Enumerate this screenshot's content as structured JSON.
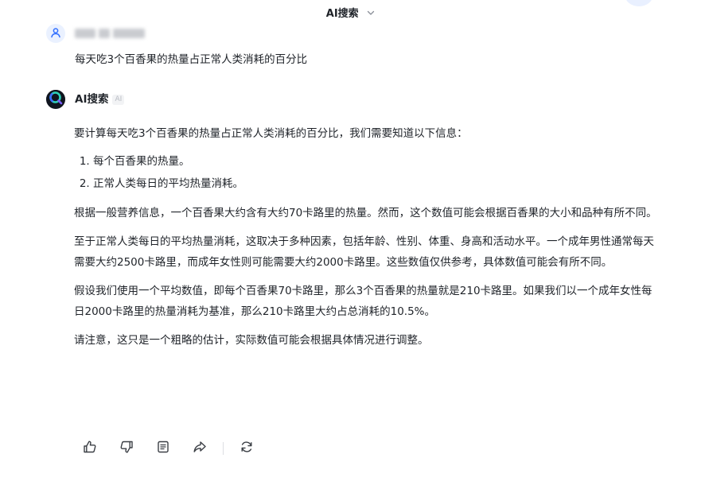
{
  "header": {
    "title": "AI搜索",
    "dropdown_icon": "chevron-down-icon"
  },
  "user": {
    "avatar_icon": "user-icon",
    "name_redacted": true,
    "question": "每天吃3个百香果的热量占正常人类消耗的百分比"
  },
  "ai": {
    "avatar_icon": "ai-search-logo",
    "name": "AI搜索",
    "badge": "AI",
    "intro": "要计算每天吃3个百香果的热量占正常人类消耗的百分比，我们需要知道以下信息：",
    "list": [
      "每个百香果的热量。",
      "正常人类每日的平均热量消耗。"
    ],
    "paragraphs": [
      "根据一般营养信息，一个百香果大约含有大约70卡路里的热量。然而，这个数值可能会根据百香果的大小和品种有所不同。",
      "至于正常人类每日的平均热量消耗，这取决于多种因素，包括年龄、性别、体重、身高和活动水平。一个成年男性通常每天需要大约2500卡路里，而成年女性则可能需要大约2000卡路里。这些数值仅供参考，具体数值可能会有所不同。",
      "假设我们使用一个平均数值，即每个百香果70卡路里，那么3个百香果的热量就是210卡路里。如果我们以一个成年女性每日2000卡路里的热量消耗为基准，那么210卡路里大约占总消耗的10.5%。",
      "请注意，这只是一个粗略的估计，实际数值可能会根据具体情况进行调整。"
    ]
  },
  "actions": [
    {
      "name": "like-button",
      "icon": "thumbs-up-icon"
    },
    {
      "name": "dislike-button",
      "icon": "thumbs-down-icon"
    },
    {
      "name": "copy-button",
      "icon": "document-icon"
    },
    {
      "name": "share-button",
      "icon": "share-icon"
    },
    {
      "name": "regenerate-button",
      "icon": "refresh-icon"
    }
  ],
  "colors": {
    "text": "#1f2329",
    "icon": "#3b3f45",
    "user_avatar_bg": "#eaf1ff",
    "user_avatar_icon": "#3370ff",
    "ai_avatar_bg": "#10151f",
    "ai_avatar_accent": "#2ed1b9"
  }
}
